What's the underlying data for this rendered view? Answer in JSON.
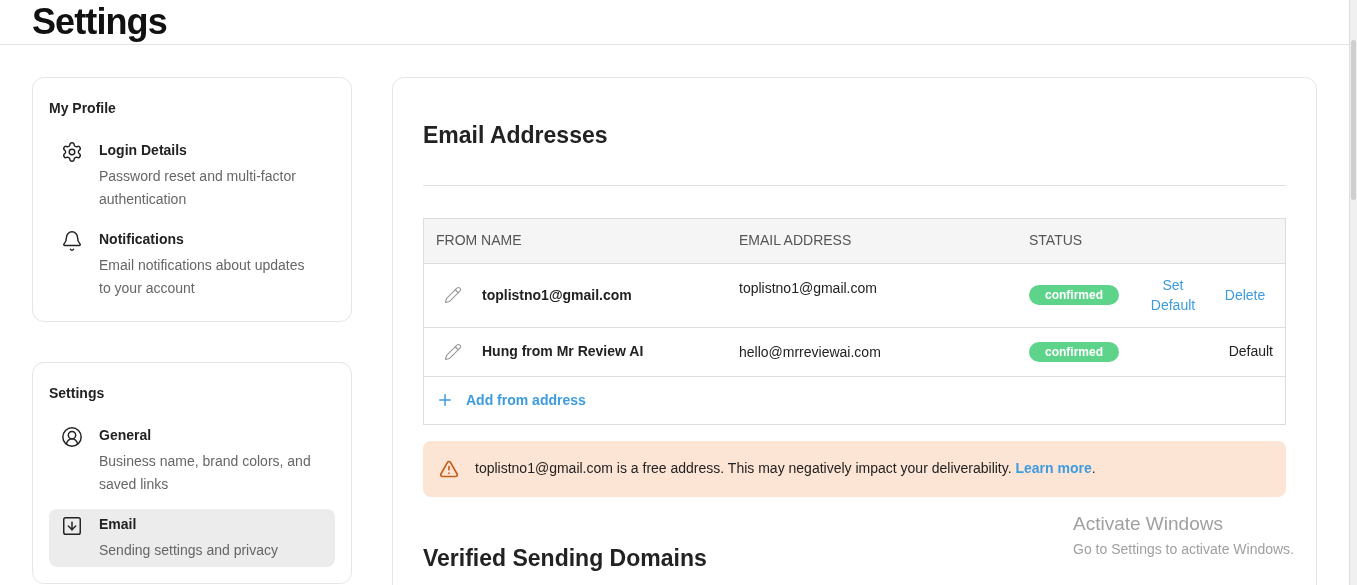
{
  "page_title": "Settings",
  "sidebar": [
    {
      "title": "My Profile",
      "items": [
        {
          "label": "Login Details",
          "description": "Password reset and multi-factor authentication",
          "selected": false
        },
        {
          "label": "Notifications",
          "description": "Email notifications about updates to your account",
          "selected": false
        }
      ]
    },
    {
      "title": "Settings",
      "items": [
        {
          "label": "General",
          "description": "Business name, brand colors, and saved links",
          "selected": false
        },
        {
          "label": "Email",
          "description": "Sending settings and privacy",
          "selected": true
        }
      ]
    }
  ],
  "email_section": {
    "title": "Email Addresses",
    "table": {
      "columns": [
        "FROM NAME",
        "EMAIL ADDRESS",
        "STATUS"
      ],
      "rows": [
        {
          "from_name": "toplistno1@gmail.com",
          "email": "toplistno1@gmail.com",
          "status": "confirmed",
          "actions": [
            {
              "kind": "link",
              "label": "Set Default"
            },
            {
              "kind": "link",
              "label": "Delete"
            }
          ]
        },
        {
          "from_name": "Hung from Mr Review AI",
          "email": "hello@mrreviewai.com",
          "status": "confirmed",
          "actions": [
            {
              "kind": "text",
              "label": "Default"
            }
          ]
        }
      ],
      "add_button": "Add from address"
    },
    "alert": {
      "message": "toplistno1@gmail.com is a free address. This may negatively impact your deliverability.",
      "link": "Learn more",
      "suffix": "."
    }
  },
  "domains_section": {
    "title": "Verified Sending Domains"
  },
  "os_notice": {
    "title": "Activate Windows",
    "subtitle": "Go to Settings to activate Windows."
  }
}
